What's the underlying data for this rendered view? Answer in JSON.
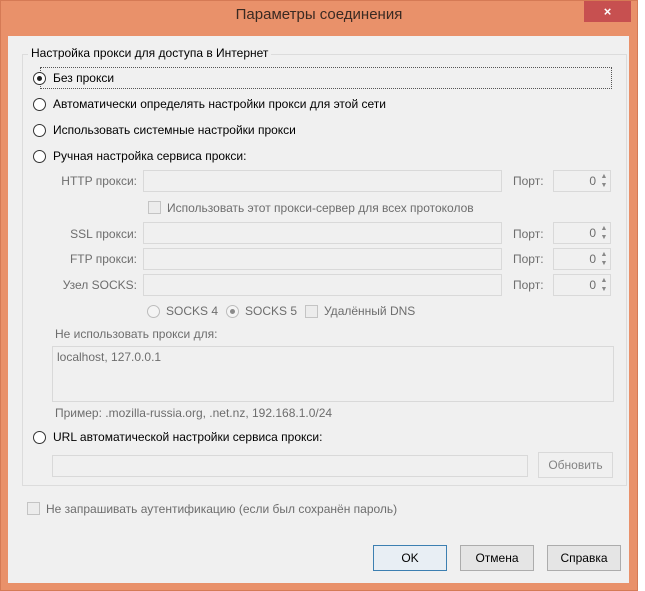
{
  "window": {
    "title": "Параметры соединения",
    "close_icon": "×"
  },
  "group": {
    "legend": "Настройка прокси для доступа в Интернет"
  },
  "proxy_modes": [
    {
      "label": "Без прокси",
      "selected": true
    },
    {
      "label": "Автоматически определять настройки прокси для этой сети",
      "selected": false
    },
    {
      "label": "Использовать системные настройки прокси",
      "selected": false
    },
    {
      "label": "Ручная настройка сервиса прокси:",
      "selected": false
    }
  ],
  "manual": {
    "http_label": "HTTP прокси:",
    "http_value": "",
    "port_label": "Порт:",
    "http_port": "0",
    "share_label": "Использовать этот прокси-сервер для всех протоколов",
    "ssl_label": "SSL прокси:",
    "ssl_port": "0",
    "ftp_label": "FTP прокси:",
    "ftp_port": "0",
    "socks_label": "Узел SOCKS:",
    "socks_port": "0",
    "socks4": "SOCKS 4",
    "socks5": "SOCKS 5",
    "remote_dns": "Удалённый DNS"
  },
  "no_proxy": {
    "label": "Не использовать прокси для:",
    "value": "localhost, 127.0.0.1",
    "example": "Пример: .mozilla-russia.org, .net.nz, 192.168.1.0/24"
  },
  "auto_url": {
    "label": "URL автоматической настройки сервиса прокси:",
    "value": "",
    "reload": "Обновить"
  },
  "no_auth": "Не запрашивать аутентификацию (если был сохранён пароль)",
  "buttons": {
    "ok": "OK",
    "cancel": "Отмена",
    "help": "Справка"
  }
}
